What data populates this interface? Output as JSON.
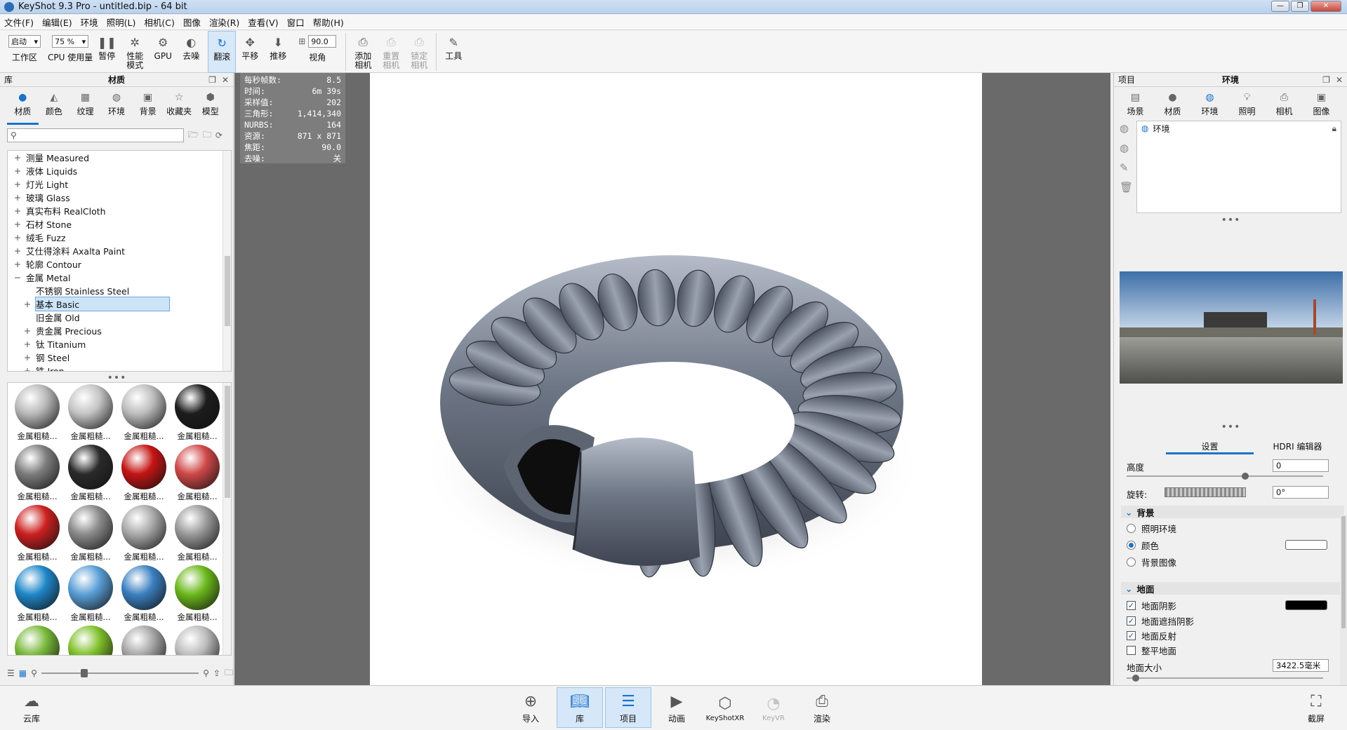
{
  "window": {
    "title": "KeyShot 9.3 Pro  - untitled.bip  - 64 bit",
    "controls": [
      "—",
      "❐",
      "✕"
    ]
  },
  "menu": [
    "文件(F)",
    "编辑(E)",
    "环境",
    "照明(L)",
    "相机(C)",
    "图像",
    "渲染(R)",
    "查看(V)",
    "窗口",
    "帮助(H)"
  ],
  "toolbar": {
    "workspace_value": "启动",
    "workspace_label": "工作区",
    "cpu_value": "75 %",
    "cpu_label": "CPU 使用量",
    "pause": "暂停",
    "perf_mode": "性能\n模式",
    "gpu": "GPU",
    "denoise": "去噪",
    "tumble": "翻滚",
    "pan": "平移",
    "dolly": "推移",
    "fov_value": "90.0",
    "fov_label": "视角",
    "add_camera": "添加\n相机",
    "reset_camera": "重置\n相机",
    "lock_camera": "锁定\n相机",
    "tools": "工具"
  },
  "library": {
    "panel_label": "库",
    "panel_title": "材质",
    "tabs": [
      "材质",
      "颜色",
      "纹理",
      "环境",
      "背景",
      "收藏夹",
      "模型"
    ],
    "search_placeholder": "",
    "tree": [
      {
        "label": "测量 Measured",
        "exp": "+",
        "level": 0
      },
      {
        "label": "液体 Liquids",
        "exp": "+",
        "level": 0
      },
      {
        "label": "灯光 Light",
        "exp": "+",
        "level": 0
      },
      {
        "label": "玻璃 Glass",
        "exp": "+",
        "level": 0
      },
      {
        "label": "真实布料 RealCloth",
        "exp": "+",
        "level": 0
      },
      {
        "label": "石材 Stone",
        "exp": "+",
        "level": 0
      },
      {
        "label": "绒毛 Fuzz",
        "exp": "+",
        "level": 0
      },
      {
        "label": "艾仕得涂料 Axalta Paint",
        "exp": "+",
        "level": 0
      },
      {
        "label": "轮廓 Contour",
        "exp": "+",
        "level": 0
      },
      {
        "label": "金属 Metal",
        "exp": "−",
        "level": 0
      },
      {
        "label": "不锈钢 Stainless Steel",
        "exp": "",
        "level": 1
      },
      {
        "label": "基本 Basic",
        "exp": "+",
        "level": 1,
        "selected": true
      },
      {
        "label": "旧金属 Old",
        "exp": "",
        "level": 1
      },
      {
        "label": "贵金属 Precious",
        "exp": "+",
        "level": 1
      },
      {
        "label": "钛 Titanium",
        "exp": "+",
        "level": 1
      },
      {
        "label": "钢 Steel",
        "exp": "+",
        "level": 1
      },
      {
        "label": "铁 Iron",
        "exp": "+",
        "level": 1
      }
    ],
    "thumbnails": [
      {
        "label": "金属粗糙...",
        "color": "#b9b9b9"
      },
      {
        "label": "金属粗糙...",
        "color": "#c4c4c4"
      },
      {
        "label": "金属粗糙...",
        "color": "#bdbdbd"
      },
      {
        "label": "金属粗糙...",
        "color": "#1c1c1c"
      },
      {
        "label": "金属粗糙...",
        "color": "#7d7d7d"
      },
      {
        "label": "金属粗糙...",
        "color": "#2a2a2a"
      },
      {
        "label": "金属粗糙...",
        "color": "#c41414"
      },
      {
        "label": "金属粗糙...",
        "color": "#d04848"
      },
      {
        "label": "金属粗糙...",
        "color": "#cc2020"
      },
      {
        "label": "金属粗糙...",
        "color": "#8a8a8a"
      },
      {
        "label": "金属粗糙...",
        "color": "#a9a9a9"
      },
      {
        "label": "金属粗糙...",
        "color": "#9a9a9a"
      },
      {
        "label": "金属粗糙...",
        "color": "#1f86c8"
      },
      {
        "label": "金属粗糙...",
        "color": "#5a9ed6"
      },
      {
        "label": "金属粗糙...",
        "color": "#3b7fc0"
      },
      {
        "label": "金属粗糙...",
        "color": "#6bb81c"
      },
      {
        "label": "",
        "color": "#78b83a"
      },
      {
        "label": "",
        "color": "#7fc02a"
      },
      {
        "label": "",
        "color": "#a6a6a6"
      },
      {
        "label": "",
        "color": "#bcbcbc"
      }
    ]
  },
  "stats": [
    {
      "k": "每秒帧数:",
      "v": "8.5"
    },
    {
      "k": "时间:",
      "v": "6m 39s"
    },
    {
      "k": "采样值:",
      "v": "202"
    },
    {
      "k": "三角形:",
      "v": "1,414,340"
    },
    {
      "k": "NURBS:",
      "v": "164"
    },
    {
      "k": "资源:",
      "v": "871 x 871"
    },
    {
      "k": "焦距:",
      "v": "90.0"
    },
    {
      "k": "去噪:",
      "v": "关"
    }
  ],
  "project": {
    "panel_label": "项目",
    "panel_title": "环境",
    "tabs": [
      "场景",
      "材质",
      "环境",
      "照明",
      "相机",
      "图像"
    ],
    "env_item": "环境",
    "subtabs": [
      "设置",
      "HDRI 编辑器"
    ],
    "height_label": "高度",
    "height_value": "0",
    "rotation_label": "旋转:",
    "rotation_value": "0°",
    "background_section": "背景",
    "bg_options": [
      "照明环境",
      "颜色",
      "背景图像"
    ],
    "bg_color": "#ffffff",
    "ground_section": "地面",
    "ground_options": [
      {
        "label": "地面阴影",
        "checked": true
      },
      {
        "label": "地面遮挡阴影",
        "checked": true
      },
      {
        "label": "地面反射",
        "checked": true
      },
      {
        "label": "整平地面",
        "checked": false
      }
    ],
    "ground_shadow_color": "#000000",
    "ground_size_label": "地面大小",
    "ground_size_value": "3422.5毫米"
  },
  "bottom": [
    "云库",
    "导入",
    "库",
    "项目",
    "动画",
    "KeyShotXR",
    "KeyVR",
    "渲染",
    "截屏"
  ]
}
